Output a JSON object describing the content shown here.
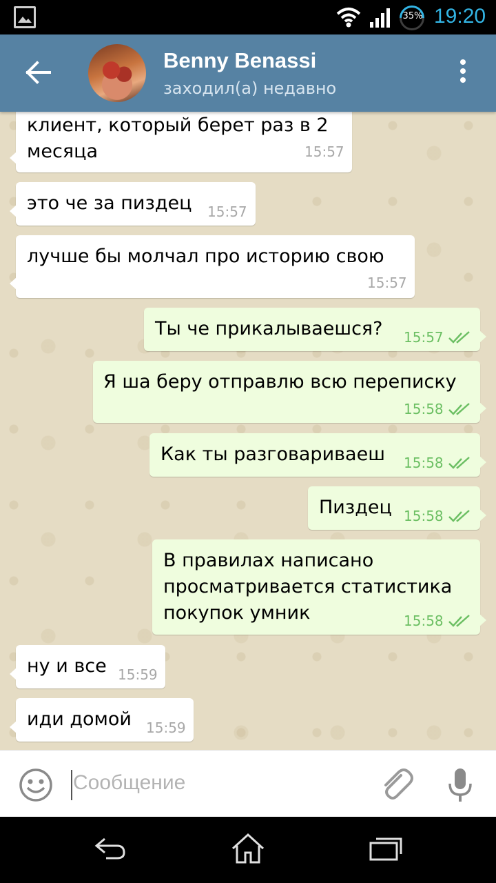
{
  "status_bar": {
    "battery": "35%",
    "time": "19:20",
    "icons": [
      "gallery-icon",
      "wifi-icon",
      "signal-icon",
      "battery-icon"
    ]
  },
  "header": {
    "title": "Benny Benassi",
    "subtitle": "заходил(а) недавно",
    "icons": [
      "back-arrow-icon",
      "avatar",
      "more-vert-icon"
    ],
    "accent_color": "#5682a3"
  },
  "messages": [
    {
      "direction": "in",
      "text": "клиент, который берет раз в 2\nмесяца",
      "time": "15:57"
    },
    {
      "direction": "in",
      "text": "это че за пиздец",
      "time": "15:57"
    },
    {
      "direction": "in",
      "text": "лучше бы молчал про историю свою",
      "time": "15:57"
    },
    {
      "direction": "out",
      "text": "Ты че прикалываешся?",
      "time": "15:57",
      "read": true
    },
    {
      "direction": "out",
      "text": "Я ша беру отправлю всю переписку",
      "time": "15:58",
      "read": true
    },
    {
      "direction": "out",
      "text": "Как ты разговариваеш",
      "time": "15:58",
      "read": true
    },
    {
      "direction": "out",
      "text": "Пиздец",
      "time": "15:58",
      "read": true
    },
    {
      "direction": "out",
      "text": "В правилах написано\nпросматривается статистика\nпокупок умник",
      "time": "15:58",
      "read": true
    },
    {
      "direction": "in",
      "text": "ну и все",
      "time": "15:59"
    },
    {
      "direction": "in",
      "text": "иди домой",
      "time": "15:59"
    }
  ],
  "input": {
    "placeholder": "Сообщение",
    "value": "",
    "icons": [
      "emoji-icon",
      "attach-icon",
      "mic-icon"
    ]
  },
  "nav_bar": {
    "icons": [
      "back-icon",
      "home-icon",
      "recent-apps-icon"
    ]
  },
  "colors": {
    "incoming_bubble": "#ffffff",
    "outgoing_bubble": "#effdde",
    "outgoing_time": "#6cbf63",
    "chat_background": "#e5dcc4",
    "status_time": "#33b5e5"
  }
}
